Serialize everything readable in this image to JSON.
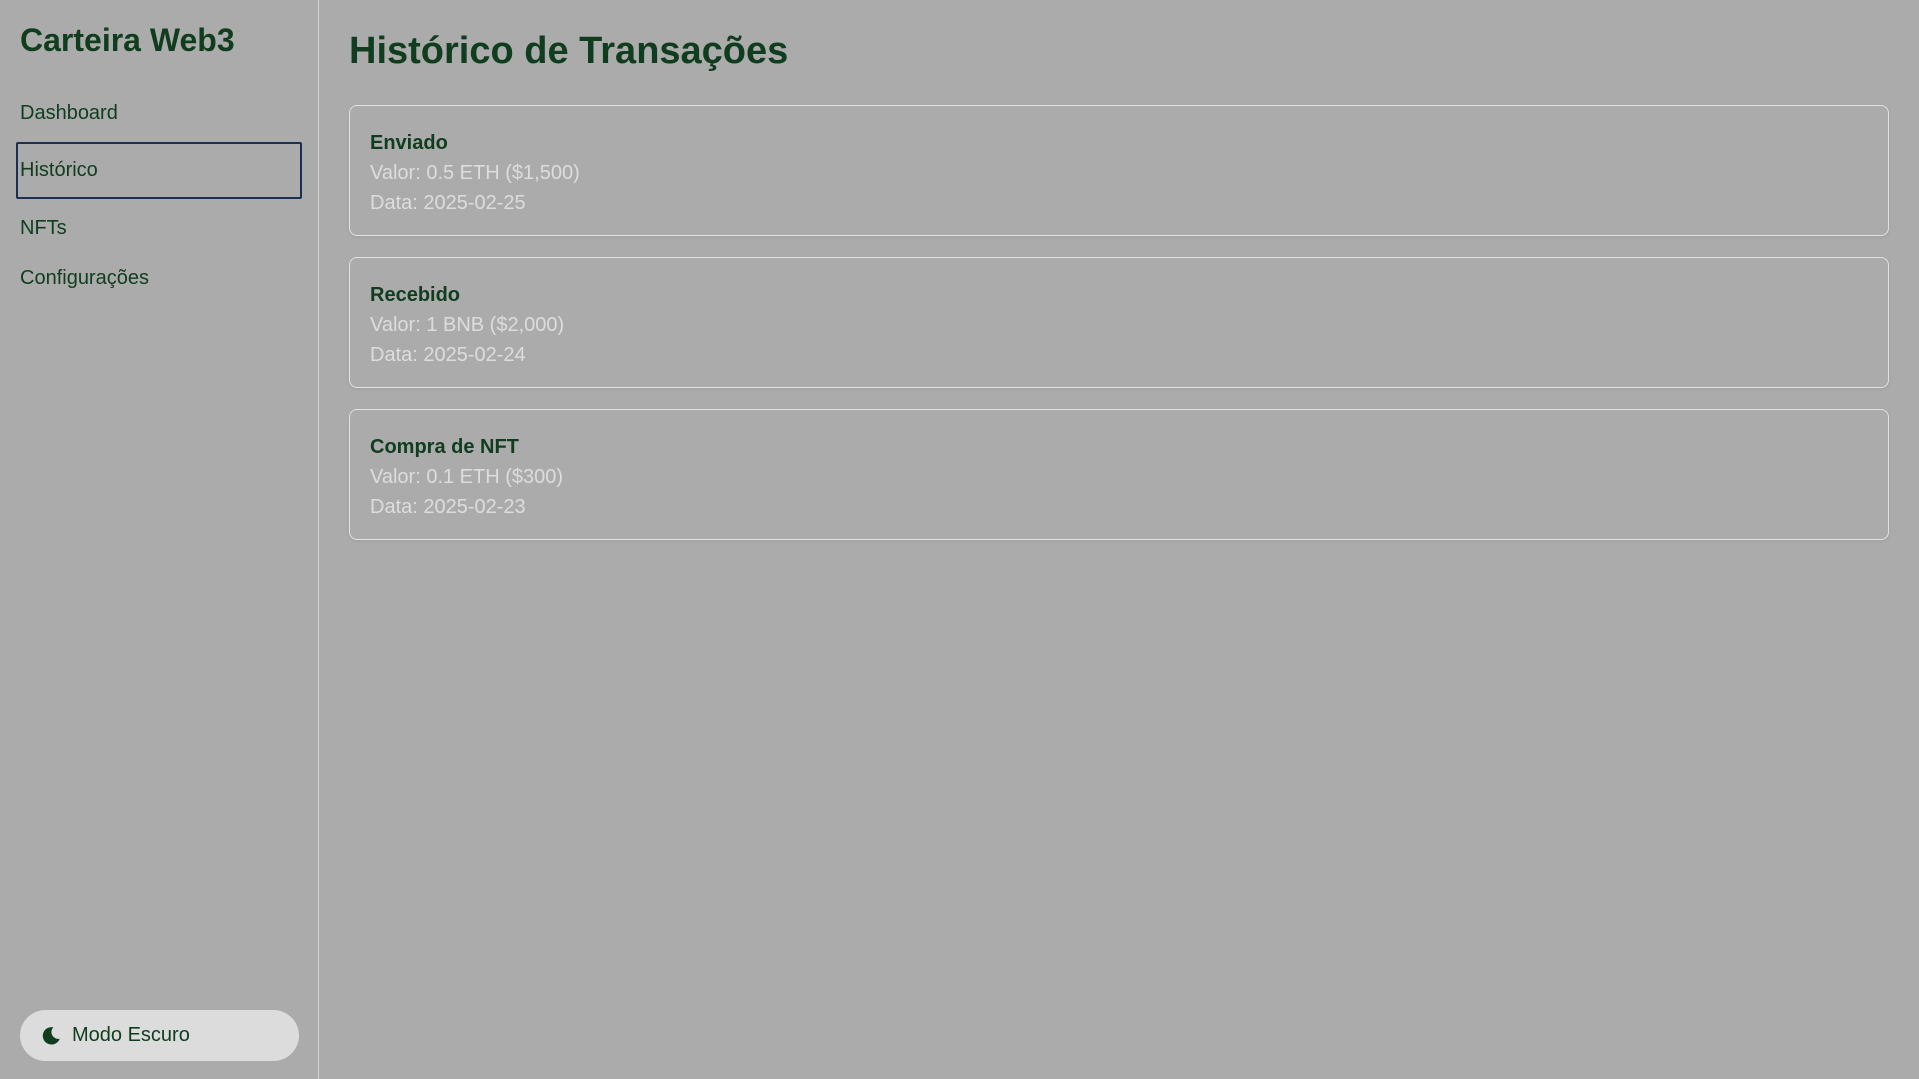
{
  "sidebar": {
    "brand": "Carteira Web3",
    "items": [
      {
        "label": "Dashboard",
        "active": false
      },
      {
        "label": "Histórico",
        "active": true
      },
      {
        "label": "NFTs",
        "active": false
      },
      {
        "label": "Configurações",
        "active": false
      }
    ],
    "theme_toggle": {
      "icon": "moon-icon",
      "label": "Modo Escuro"
    }
  },
  "main": {
    "title": "Histórico de Transações",
    "transactions": [
      {
        "type": "Enviado",
        "value": "Valor: 0.5 ETH ($1,500)",
        "date": "Data: 2025-02-25"
      },
      {
        "type": "Recebido",
        "value": "Valor: 1 BNB ($2,000)",
        "date": "Data: 2025-02-24"
      },
      {
        "type": "Compra de NFT",
        "value": "Valor: 0.1 ETH ($300)",
        "date": "Data: 2025-02-23"
      }
    ]
  },
  "colors": {
    "background": "#ababab",
    "accent_text": "#0f3d1e",
    "muted_text": "#dddddd",
    "active_border": "#1b2f52",
    "toggle_bg": "#dcdcdc"
  }
}
